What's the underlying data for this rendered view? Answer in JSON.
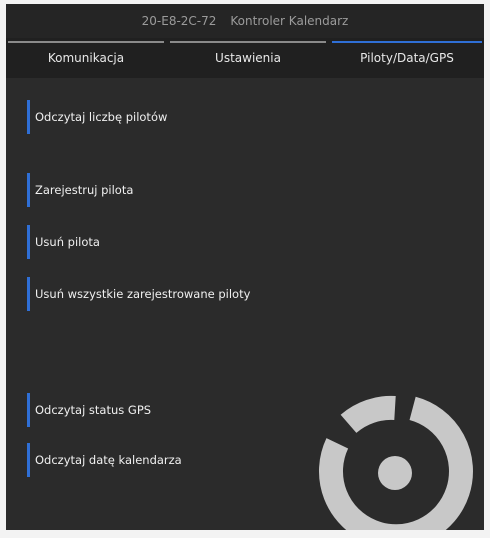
{
  "window": {
    "device_id": "20-E8-2C-72",
    "app_title": "Kontroler Kalendarz"
  },
  "tabs": [
    {
      "label": "Komunikacja",
      "active": false
    },
    {
      "label": "Ustawienia",
      "active": false
    },
    {
      "label": "Piloty/Data/GPS",
      "active": true
    }
  ],
  "actions": [
    {
      "label": "Odczytaj liczbę pilotów"
    },
    {
      "label": "Zarejestruj pilota"
    },
    {
      "label": "Usuń pilota"
    },
    {
      "label": "Usuń wszystkie zarejestrowane piloty"
    },
    {
      "label": "Odczytaj status GPS"
    },
    {
      "label": "Odczytaj datę kalendarza"
    }
  ],
  "colors": {
    "accent": "#2f6fd6",
    "background": "#2b2b2b",
    "spinner": "#c8c8c8"
  },
  "icons": {
    "busy_indicator": "loading-spinner-icon"
  }
}
